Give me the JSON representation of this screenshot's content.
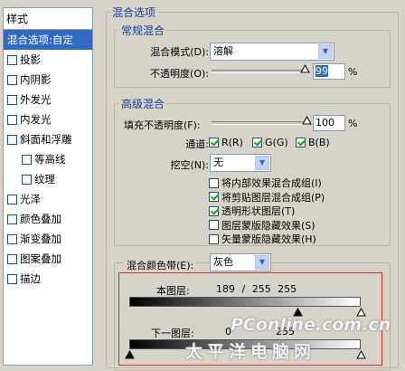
{
  "sidebar": {
    "header": "样式",
    "items": [
      {
        "label": "混合选项:自定",
        "selected": true,
        "checkbox": false,
        "checked": false,
        "indent": 0
      },
      {
        "label": "投影",
        "selected": false,
        "checkbox": true,
        "checked": false,
        "indent": 0
      },
      {
        "label": "内阴影",
        "selected": false,
        "checkbox": true,
        "checked": false,
        "indent": 0
      },
      {
        "label": "外发光",
        "selected": false,
        "checkbox": true,
        "checked": false,
        "indent": 0
      },
      {
        "label": "内发光",
        "selected": false,
        "checkbox": true,
        "checked": false,
        "indent": 0
      },
      {
        "label": "斜面和浮雕",
        "selected": false,
        "checkbox": true,
        "checked": false,
        "indent": 0
      },
      {
        "label": "等高线",
        "selected": false,
        "checkbox": true,
        "checked": false,
        "indent": 1
      },
      {
        "label": "纹理",
        "selected": false,
        "checkbox": true,
        "checked": false,
        "indent": 1
      },
      {
        "label": "光泽",
        "selected": false,
        "checkbox": true,
        "checked": false,
        "indent": 0
      },
      {
        "label": "颜色叠加",
        "selected": false,
        "checkbox": true,
        "checked": false,
        "indent": 0
      },
      {
        "label": "渐变叠加",
        "selected": false,
        "checkbox": true,
        "checked": false,
        "indent": 0
      },
      {
        "label": "图案叠加",
        "selected": false,
        "checkbox": true,
        "checked": false,
        "indent": 0
      },
      {
        "label": "描边",
        "selected": false,
        "checkbox": true,
        "checked": false,
        "indent": 0
      }
    ]
  },
  "blend_options": {
    "title": "混合选项",
    "general": {
      "title": "常规混合",
      "mode_label": "混合模式(D):",
      "mode_value": "溶解",
      "opacity_label": "不透明度(O):",
      "opacity_value": "99",
      "percent": "%"
    },
    "advanced": {
      "title": "高级混合",
      "fill_label": "填充不透明度(F):",
      "fill_value": "100",
      "percent": "%",
      "channels_label": "通道:",
      "channel_r": "R(R)",
      "channel_g": "G(G)",
      "channel_b": "B(B)",
      "knockout_label": "挖空(N):",
      "knockout_value": "无",
      "options": [
        {
          "label": "将内部效果混合成组(I)",
          "checked": false
        },
        {
          "label": "将剪贴图层混合成组(P)",
          "checked": true
        },
        {
          "label": "透明形状图层(T)",
          "checked": true
        },
        {
          "label": "图层蒙版隐藏效果(S)",
          "checked": false
        },
        {
          "label": "矢量蒙版隐藏效果(H)",
          "checked": false
        }
      ]
    },
    "blend_if": {
      "label": "混合颜色带(E):",
      "value": "灰色",
      "this_layer_label": "本图层:",
      "this_layer_values": "189 / 255   255",
      "underlying_label": "下一图层:",
      "underlying_low": "0",
      "underlying_high": "255"
    }
  },
  "watermark": {
    "brand": "PConline.com.cn",
    "chinese": "太平洋电脑网"
  },
  "colors": {
    "selection": "#316ac5",
    "group_title": "#1c3f94",
    "highlight_box": "#d0302f"
  }
}
